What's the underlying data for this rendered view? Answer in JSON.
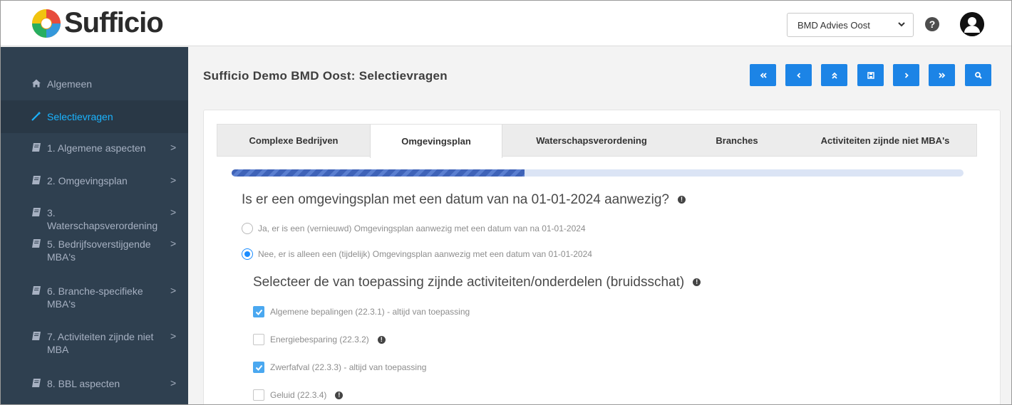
{
  "app": {
    "name": "Sufficio",
    "organization_selected": "BMD Advies Oost",
    "help_icon": "question-circle-icon",
    "avatar_icon": "user-avatar-icon"
  },
  "sidebar": {
    "items": [
      {
        "label": "Algemeen",
        "icon": "home-icon",
        "active": false,
        "arrow": false
      },
      {
        "label": "Selectievragen",
        "icon": "magic-wand-icon",
        "active": true,
        "arrow": false
      },
      {
        "label": "1. Algemene aspecten",
        "icon": "book-icon",
        "active": false,
        "arrow": true
      },
      {
        "label": "2. Omgevingsplan",
        "icon": "book-icon",
        "active": false,
        "arrow": true
      },
      {
        "label": "3. Waterschapsverordening",
        "icon": "book-icon",
        "active": false,
        "arrow": true
      },
      {
        "label": "5. Bedrijfsoverstijgende MBA's",
        "icon": "book-icon",
        "active": false,
        "arrow": true
      },
      {
        "label": "6. Branche-specifieke MBA's",
        "icon": "book-icon",
        "active": false,
        "arrow": true
      },
      {
        "label": "7. Activiteiten zijnde niet MBA",
        "icon": "book-icon",
        "active": false,
        "arrow": true
      },
      {
        "label": "8. BBL aspecten",
        "icon": "book-icon",
        "active": false,
        "arrow": true
      }
    ],
    "arrow_glyph": ">"
  },
  "main": {
    "title": "Sufficio Demo BMD Oost: Selectievragen",
    "nav_buttons": [
      {
        "glyph": "«",
        "icon": "double-chevron-left-icon"
      },
      {
        "glyph": "‹",
        "icon": "chevron-left-icon"
      },
      {
        "glyph": "⌃",
        "icon": "double-chevron-up-icon"
      },
      {
        "glyph": "💾",
        "icon": "save-icon"
      },
      {
        "glyph": "›",
        "icon": "chevron-right-icon"
      },
      {
        "glyph": "»",
        "icon": "double-chevron-right-icon"
      },
      {
        "glyph": "🔍",
        "icon": "search-icon"
      }
    ],
    "tabs": [
      {
        "label": "Complexe Bedrijven",
        "active": false
      },
      {
        "label": "Omgevingsplan",
        "active": true
      },
      {
        "label": "Waterschapsverordening",
        "active": false
      },
      {
        "label": "Branches",
        "active": false
      },
      {
        "label": "Activiteiten zijnde niet MBA's",
        "active": false
      }
    ],
    "progress_fraction": 0.4,
    "question": "Is er een omgevingsplan met een datum van na 01-01-2024 aanwezig?",
    "radio_options": [
      {
        "label": "Ja, er is een (vernieuwd) Omgevingsplan aanwezig met een datum van na 01-01-2024",
        "selected": false
      },
      {
        "label": "Nee, er is alleen een (tijdelijk) Omgevingsplan aanwezig met een datum van 01-01-2024",
        "selected": true
      }
    ],
    "subquestion": "Selecteer de van toepassing zijnde activiteiten/onderdelen (bruidsschat)",
    "checkboxes": [
      {
        "label": "Algemene bepalingen (22.3.1) - altijd van toepassing",
        "checked": true,
        "info": false
      },
      {
        "label": "Energiebesparing (22.3.2)",
        "checked": false,
        "info": true
      },
      {
        "label": "Zwerfafval (22.3.3) - altijd van toepassing",
        "checked": true,
        "info": false
      },
      {
        "label": "Geluid (22.3.4)",
        "checked": false,
        "info": true
      }
    ],
    "info_glyph": "!"
  },
  "colors": {
    "sidebar_bg": "#2f4050",
    "sidebar_active_text": "#1ab4ff",
    "nav_button_bg": "#1c84e6",
    "progress_fill": "#3f63b8",
    "checkbox_checked": "#4aa8f0",
    "radio_selected": "#1a8cff"
  }
}
